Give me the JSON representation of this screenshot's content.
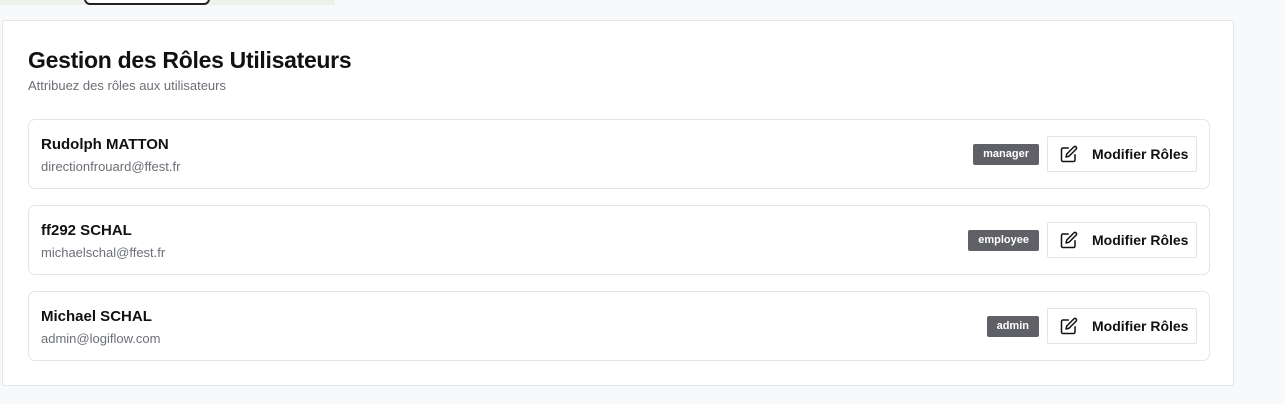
{
  "header": {
    "title": "Gestion des Rôles Utilisateurs",
    "subtitle": "Attribuez des rôles aux utilisateurs"
  },
  "users": [
    {
      "name": "Rudolph MATTON",
      "email": "directionfrouard@ffest.fr",
      "role": "manager",
      "action_label": "Modifier Rôles",
      "action_icon": "edit-icon"
    },
    {
      "name": "ff292 SCHAL",
      "email": "michaelschal@ffest.fr",
      "role": "employee",
      "action_label": "Modifier Rôles",
      "action_icon": "edit-icon"
    },
    {
      "name": "Michael SCHAL",
      "email": "admin@logiflow.com",
      "role": "admin",
      "action_label": "Modifier Rôles",
      "action_icon": "edit-icon"
    }
  ],
  "colors": {
    "badge": "#5f6166",
    "border": "#e3e5e8",
    "background": "#f8f9fa"
  }
}
